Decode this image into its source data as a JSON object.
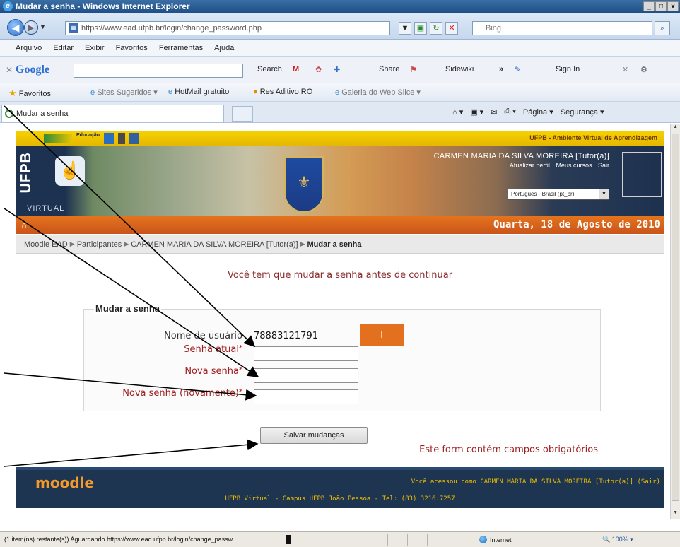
{
  "window": {
    "title": "Mudar a senha - Windows Internet Explorer",
    "buttons": [
      "_",
      "□",
      "x"
    ]
  },
  "address": {
    "url": "https://www.ead.ufpb.br/login/change_password.php",
    "search_placeholder": "Bing"
  },
  "menu": {
    "items": [
      "Arquivo",
      "Editar",
      "Exibir",
      "Favoritos",
      "Ferramentas",
      "Ajuda"
    ]
  },
  "google_toolbar": {
    "logo": "Google",
    "search_label": "Search",
    "share_label": "Share",
    "sidewiki_label": "Sidewiki",
    "more": "»",
    "signin_label": "Sign In"
  },
  "favorites": {
    "label": "Favoritos",
    "items": [
      "Sites Sugeridos",
      "HotMail gratuito",
      "Res Aditivo RO",
      "Galeria do Web Slice"
    ]
  },
  "tabs": {
    "active_label": "Mudar a senha",
    "tools": [
      "Página",
      "Segurança"
    ]
  },
  "site": {
    "top_right": "UFPB - Ambiente Virtual de Aprendizagem",
    "topbar_logo": "Educação",
    "brand_letters": "UFPB",
    "brand_sub": "VIRTUAL",
    "user_name": "CARMEN MARIA DA SILVA MOREIRA [Tutor(a)]",
    "user_links": [
      "Atualizar perfil",
      "Meus cursos",
      "Sair"
    ],
    "language": "Português - Brasil (pt_br)",
    "date": "Quarta, 18 de Agosto de 2010"
  },
  "breadcrumb": {
    "items": [
      "Moodle EAD",
      "Participantes",
      "CARMEN MARIA DA SILVA MOREIRA [Tutor(a)]"
    ],
    "current": "Mudar a senha",
    "separator": "▶"
  },
  "form": {
    "notice": "Você tem que mudar a senha antes de continuar",
    "legend": "Mudar a senha",
    "username_label": "Nome de usuário",
    "username_value": "78883121791",
    "current_label": "Senha atual",
    "new_label": "Nova senha",
    "new2_label": "Nova senha (novamente)",
    "required_mark": "*",
    "orange_box_text": "I",
    "submit_label": "Salvar mudanças",
    "required_note": "Este form contém campos obrigatórios"
  },
  "footer": {
    "logo": "moodle",
    "logged_as": "Você acessou como CARMEN MARIA DA SILVA MOREIRA [Tutor(a)] (Sair)",
    "campus": "UFPB Virtual - Campus UFPB João Pessoa - Tel: (83) 3216.7257"
  },
  "status": {
    "text": "(1 item(ns) restante(s)) Aguardando https://www.ead.ufpb.br/login/change_passw",
    "zone": "Internet",
    "zoom": "100%"
  },
  "colors": {
    "orange_bar": "#d8621c",
    "header_yellow": "#f0c800",
    "footer_navy": "#1e3552",
    "required_red": "#a02020"
  }
}
